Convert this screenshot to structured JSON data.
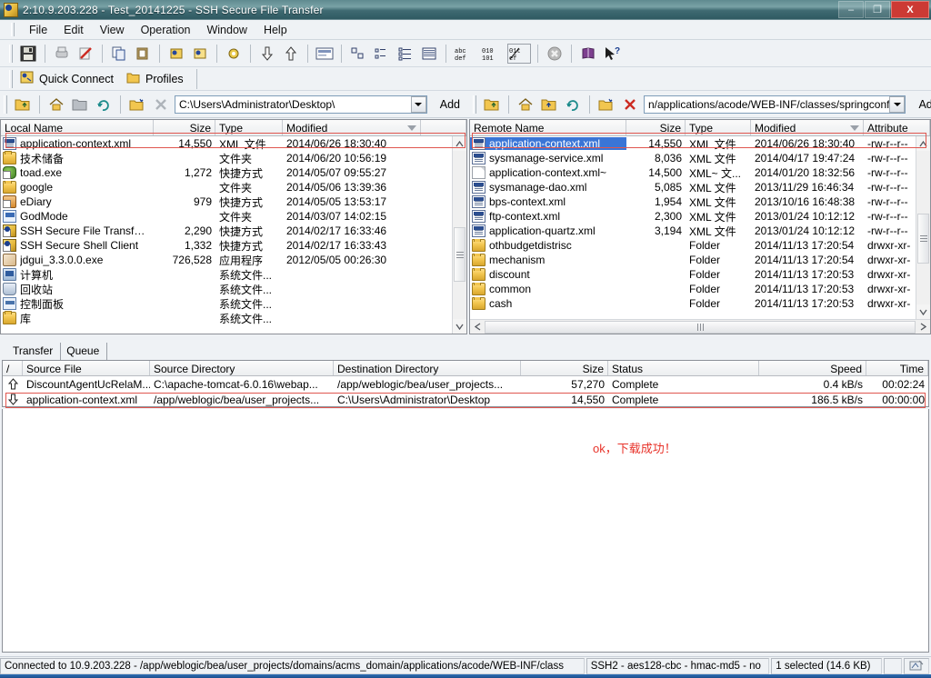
{
  "window": {
    "title": "2:10.9.203.228 - Test_20141225 - SSH Secure File Transfer",
    "minimize_label": "–",
    "restore_label": "❐",
    "close_label": "X",
    "title_icon": "app-icon"
  },
  "menu": {
    "items": [
      {
        "label": "File"
      },
      {
        "label": "Edit"
      },
      {
        "label": "View"
      },
      {
        "label": "Operation"
      },
      {
        "label": "Window"
      },
      {
        "label": "Help"
      }
    ]
  },
  "toolbar": {
    "icons": [
      {
        "name": "save-icon",
        "glyph": "💾"
      },
      {
        "name": "print-icon",
        "glyph": "⎙"
      },
      {
        "name": "print-preview-icon",
        "glyph": "✎"
      },
      {
        "name": "copy-icon",
        "glyph": "⧉"
      },
      {
        "name": "paste-icon",
        "glyph": "▧"
      },
      {
        "name": "new-connect-icon",
        "glyph": "⬚"
      },
      {
        "name": "disconnect-icon",
        "glyph": "⬚"
      },
      {
        "name": "settings-icon",
        "glyph": "⚙"
      },
      {
        "name": "download-icon",
        "glyph": "⇩"
      },
      {
        "name": "upload-icon",
        "glyph": "⇧"
      },
      {
        "name": "toggle-local-pane-icon",
        "glyph": "▤"
      },
      {
        "name": "view-largeicons-icon",
        "glyph": "▫"
      },
      {
        "name": "view-smallicons-icon",
        "glyph": "▪"
      },
      {
        "name": "view-list-icon",
        "glyph": "≣"
      },
      {
        "name": "view-details-icon",
        "glyph": "☷"
      },
      {
        "name": "ascii-transfer-icon",
        "glyph": "abc"
      },
      {
        "name": "binary-transfer-icon",
        "glyph": "010"
      },
      {
        "name": "auto-transfer-icon",
        "glyph": "01̸"
      },
      {
        "name": "stop-icon",
        "glyph": "✖"
      },
      {
        "name": "help-book-icon",
        "glyph": "📕"
      },
      {
        "name": "context-help-icon",
        "glyph": "↖?"
      }
    ]
  },
  "quickbar": {
    "quick_connect": "Quick Connect",
    "profiles": "Profiles"
  },
  "local_path": {
    "value": "C:\\Users\\Administrator\\Desktop\\",
    "add_label": "Add",
    "buttons": [
      "up-one-level-icon",
      "home-icon",
      "new-folder-icon",
      "refresh-icon",
      "new-window-icon",
      "delete-icon"
    ]
  },
  "remote_path": {
    "value": "n/applications/acode/WEB-INF/classes/springconf",
    "add_label": "Add",
    "buttons": [
      "up-one-level-icon",
      "home-icon",
      "new-folder-icon",
      "refresh-icon",
      "new-window-icon",
      "delete-icon"
    ]
  },
  "local_panel": {
    "columns": [
      "Local Name",
      "Size",
      "Type",
      "Modified"
    ],
    "sorted_column": "Modified",
    "rows": [
      {
        "icon": "xml-file-icon",
        "name": "application-context.xml",
        "size": "14,550",
        "type": "XML 文件",
        "modified": "2014/06/26 18:30:40",
        "selected": false,
        "highlighted": true
      },
      {
        "icon": "folder-icon",
        "name": "技术储备",
        "size": "",
        "type": "文件夹",
        "modified": "2014/06/20 10:56:19"
      },
      {
        "icon": "toad-app-icon",
        "name": "toad.exe",
        "size": "1,272",
        "type": "快捷方式",
        "modified": "2014/05/07 09:55:27"
      },
      {
        "icon": "folder-icon",
        "name": "google",
        "size": "",
        "type": "文件夹",
        "modified": "2014/05/06 13:39:36"
      },
      {
        "icon": "ediary-app-icon",
        "name": "eDiary",
        "size": "979",
        "type": "快捷方式",
        "modified": "2014/05/05 13:53:17"
      },
      {
        "icon": "godmode-icon",
        "name": "GodMode",
        "size": "",
        "type": "文件夹",
        "modified": "2014/03/07 14:02:15"
      },
      {
        "icon": "ssh-app-icon",
        "name": "SSH Secure File Transfer C...",
        "size": "2,290",
        "type": "快捷方式",
        "modified": "2014/02/17 16:33:46"
      },
      {
        "icon": "ssh-app-icon",
        "name": "SSH Secure Shell Client",
        "size": "1,332",
        "type": "快捷方式",
        "modified": "2014/02/17 16:33:43"
      },
      {
        "icon": "jdgui-app-icon",
        "name": "jdgui_3.3.0.0.exe",
        "size": "726,528",
        "type": "应用程序",
        "modified": "2012/05/05 00:26:30"
      },
      {
        "icon": "computer-icon",
        "name": "计算机",
        "size": "",
        "type": "系统文件...",
        "modified": ""
      },
      {
        "icon": "recycle-bin-icon",
        "name": "回收站",
        "size": "",
        "type": "系统文件...",
        "modified": ""
      },
      {
        "icon": "control-panel-icon",
        "name": "控制面板",
        "size": "",
        "type": "系统文件...",
        "modified": ""
      },
      {
        "icon": "library-icon",
        "name": "库",
        "size": "",
        "type": "系统文件...",
        "modified": ""
      }
    ]
  },
  "remote_panel": {
    "columns": [
      "Remote Name",
      "Size",
      "Type",
      "Modified",
      "Attribute"
    ],
    "sorted_column": "Modified",
    "rows": [
      {
        "icon": "xml-file-icon",
        "name": "application-context.xml",
        "size": "14,550",
        "type": "XML 文件",
        "modified": "2014/06/26 18:30:40",
        "attribute": "-rw-r--r--",
        "selected": true,
        "highlighted": true
      },
      {
        "icon": "xml-file-icon",
        "name": "sysmanage-service.xml",
        "size": "8,036",
        "type": "XML 文件",
        "modified": "2014/04/17 19:47:24",
        "attribute": "-rw-r--r--"
      },
      {
        "icon": "plain-file-icon",
        "name": "application-context.xml~",
        "size": "14,500",
        "type": "XML~ 文...",
        "modified": "2014/01/20 18:32:56",
        "attribute": "-rw-r--r--"
      },
      {
        "icon": "xml-file-icon",
        "name": "sysmanage-dao.xml",
        "size": "5,085",
        "type": "XML 文件",
        "modified": "2013/11/29 16:46:34",
        "attribute": "-rw-r--r--"
      },
      {
        "icon": "xml-file-icon",
        "name": "bps-context.xml",
        "size": "1,954",
        "type": "XML 文件",
        "modified": "2013/10/16 16:48:38",
        "attribute": "-rw-r--r--"
      },
      {
        "icon": "xml-file-icon",
        "name": "ftp-context.xml",
        "size": "2,300",
        "type": "XML 文件",
        "modified": "2013/01/24 10:12:12",
        "attribute": "-rw-r--r--"
      },
      {
        "icon": "xml-file-icon",
        "name": "application-quartz.xml",
        "size": "3,194",
        "type": "XML 文件",
        "modified": "2013/01/24 10:12:12",
        "attribute": "-rw-r--r--"
      },
      {
        "icon": "folder-icon",
        "name": "othbudgetdistrisc",
        "size": "",
        "type": "Folder",
        "modified": "2014/11/13 17:20:54",
        "attribute": "drwxr-xr-"
      },
      {
        "icon": "folder-icon",
        "name": "mechanism",
        "size": "",
        "type": "Folder",
        "modified": "2014/11/13 17:20:54",
        "attribute": "drwxr-xr-"
      },
      {
        "icon": "folder-icon",
        "name": "discount",
        "size": "",
        "type": "Folder",
        "modified": "2014/11/13 17:20:53",
        "attribute": "drwxr-xr-"
      },
      {
        "icon": "folder-icon",
        "name": "common",
        "size": "",
        "type": "Folder",
        "modified": "2014/11/13 17:20:53",
        "attribute": "drwxr-xr-"
      },
      {
        "icon": "folder-icon",
        "name": "cash",
        "size": "",
        "type": "Folder",
        "modified": "2014/11/13 17:20:53",
        "attribute": "drwxr-xr-"
      }
    ]
  },
  "transfer": {
    "tabs": [
      {
        "label": "Transfer",
        "active": true
      },
      {
        "label": "Queue",
        "active": false
      }
    ],
    "columns": [
      "/",
      "Source File",
      "Source Directory",
      "Destination Directory",
      "Size",
      "Status",
      "Speed",
      "Time"
    ],
    "rows": [
      {
        "direction": "upload-arrow-icon",
        "source_file": "DiscountAgentUcRelaM...",
        "source_dir": "C:\\apache-tomcat-6.0.16\\webap...",
        "dest_dir": "/app/weblogic/bea/user_projects...",
        "size": "57,270",
        "status": "Complete",
        "speed": "0.4 kB/s",
        "time": "00:02:24",
        "highlighted": false
      },
      {
        "direction": "download-arrow-icon",
        "source_file": "application-context.xml",
        "source_dir": "/app/weblogic/bea/user_projects...",
        "dest_dir": "C:\\Users\\Administrator\\Desktop",
        "size": "14,550",
        "status": "Complete",
        "speed": "186.5 kB/s",
        "time": "00:00:00",
        "highlighted": true
      }
    ]
  },
  "annotation": {
    "text": "ok，下载成功！",
    "color": "#e8332a"
  },
  "statusbar": {
    "connection": "Connected to 10.9.203.228 - /app/weblogic/bea/user_projects/domains/acms_domain/applications/acode/WEB-INF/class",
    "cipher": "SSH2 - aes128-cbc - hmac-md5 - no",
    "selection": "1 selected (14.6 KB)",
    "indicator_icon": "transfer-activity-icon"
  }
}
